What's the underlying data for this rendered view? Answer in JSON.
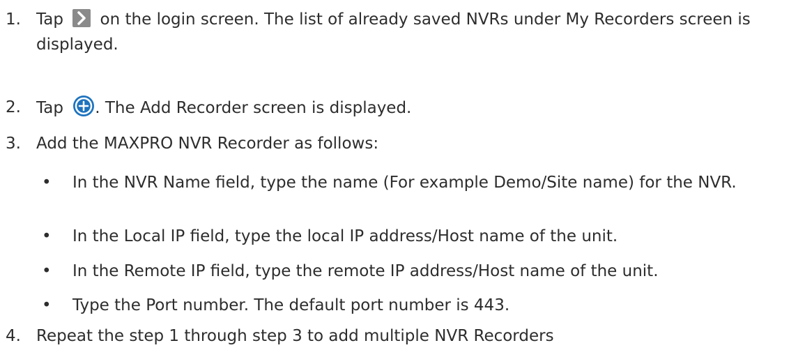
{
  "steps": [
    {
      "number": "1.",
      "pre": "Tap",
      "icon": "chevron-right-icon",
      "post": "on the login screen. The list of already saved NVRs under My Recorders screen is displayed."
    },
    {
      "number": "2.",
      "pre": "Tap",
      "icon": "add-circle-icon",
      "post": ". The Add Recorder screen is displayed."
    },
    {
      "number": "3.",
      "text": "Add the MAXPRO NVR Recorder as follows:",
      "bullets": [
        "In the NVR Name field, type the name (For example Demo/Site name) for the NVR.",
        "In the Local IP field, type the local IP address/Host name of the unit.",
        "In the Remote IP field, type the remote IP address/Host name of the unit.",
        "Type the Port number. The default port number is 443."
      ]
    },
    {
      "number": "4.",
      "text": "Repeat the step 1 through step 3 to add multiple NVR Recorders"
    }
  ],
  "bullet_char": "•",
  "colors": {
    "text": "#2d2d2d",
    "arrow_icon_bg": "#8a8a8a",
    "plus_icon": "#1e73be"
  }
}
